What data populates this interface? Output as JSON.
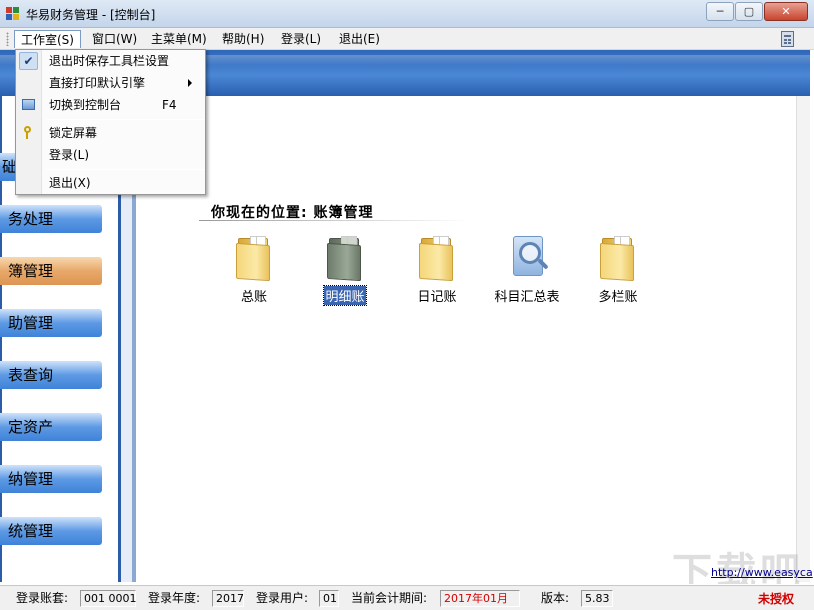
{
  "window": {
    "title": "华易财务管理 - [控制台]",
    "controls": {
      "minimize": "─",
      "maximize": "▢",
      "close": "✕"
    }
  },
  "menu": {
    "items": [
      "工作室(S)",
      "窗口(W)",
      "主菜单(M)",
      "帮助(H)",
      "登录(L)",
      "退出(E)"
    ]
  },
  "dropdown": {
    "items": [
      {
        "label": "退出时保存工具栏设置",
        "checked": true
      },
      {
        "label": "直接打印默认引擎",
        "submenu": true
      },
      {
        "label": "切换到控制台",
        "shortcut": "F4",
        "icon": "console-icon"
      },
      {
        "label": "锁定屏幕",
        "icon": "key-icon"
      },
      {
        "label": "登录(L)"
      },
      {
        "label": "退出(X)"
      }
    ]
  },
  "sidebar": {
    "items": [
      "础",
      "务处理",
      "簿管理",
      "助管理",
      "表查询",
      "定资产",
      "纳管理",
      "统管理"
    ],
    "active_index": 2
  },
  "main": {
    "location": "你现在的位置: 账簿管理",
    "modules": [
      {
        "label": "总账",
        "icon": "folder-icon"
      },
      {
        "label": "明细账",
        "icon": "folder-gray-icon",
        "selected": true
      },
      {
        "label": "日记账",
        "icon": "folder-icon"
      },
      {
        "label": "科目汇总表",
        "icon": "magnifier-document-icon"
      },
      {
        "label": "多栏账",
        "icon": "folder-icon"
      }
    ]
  },
  "status": {
    "account_label": "登录账套:",
    "account_value": "001 0001",
    "year_label": "登录年度:",
    "year_value": "2017",
    "user_label": "登录用户:",
    "user_value": "01",
    "period_label": "当前会计期间:",
    "period_value": "2017年01月",
    "version_label": "版本:",
    "version_value": "5.83",
    "unauthorized": "未授权",
    "website": "http://www.easyca"
  },
  "watermark": "下载吧",
  "colors": {
    "accent_blue": "#3f82d8",
    "active_orange": "#dd9552",
    "status_red": "#d40000"
  }
}
